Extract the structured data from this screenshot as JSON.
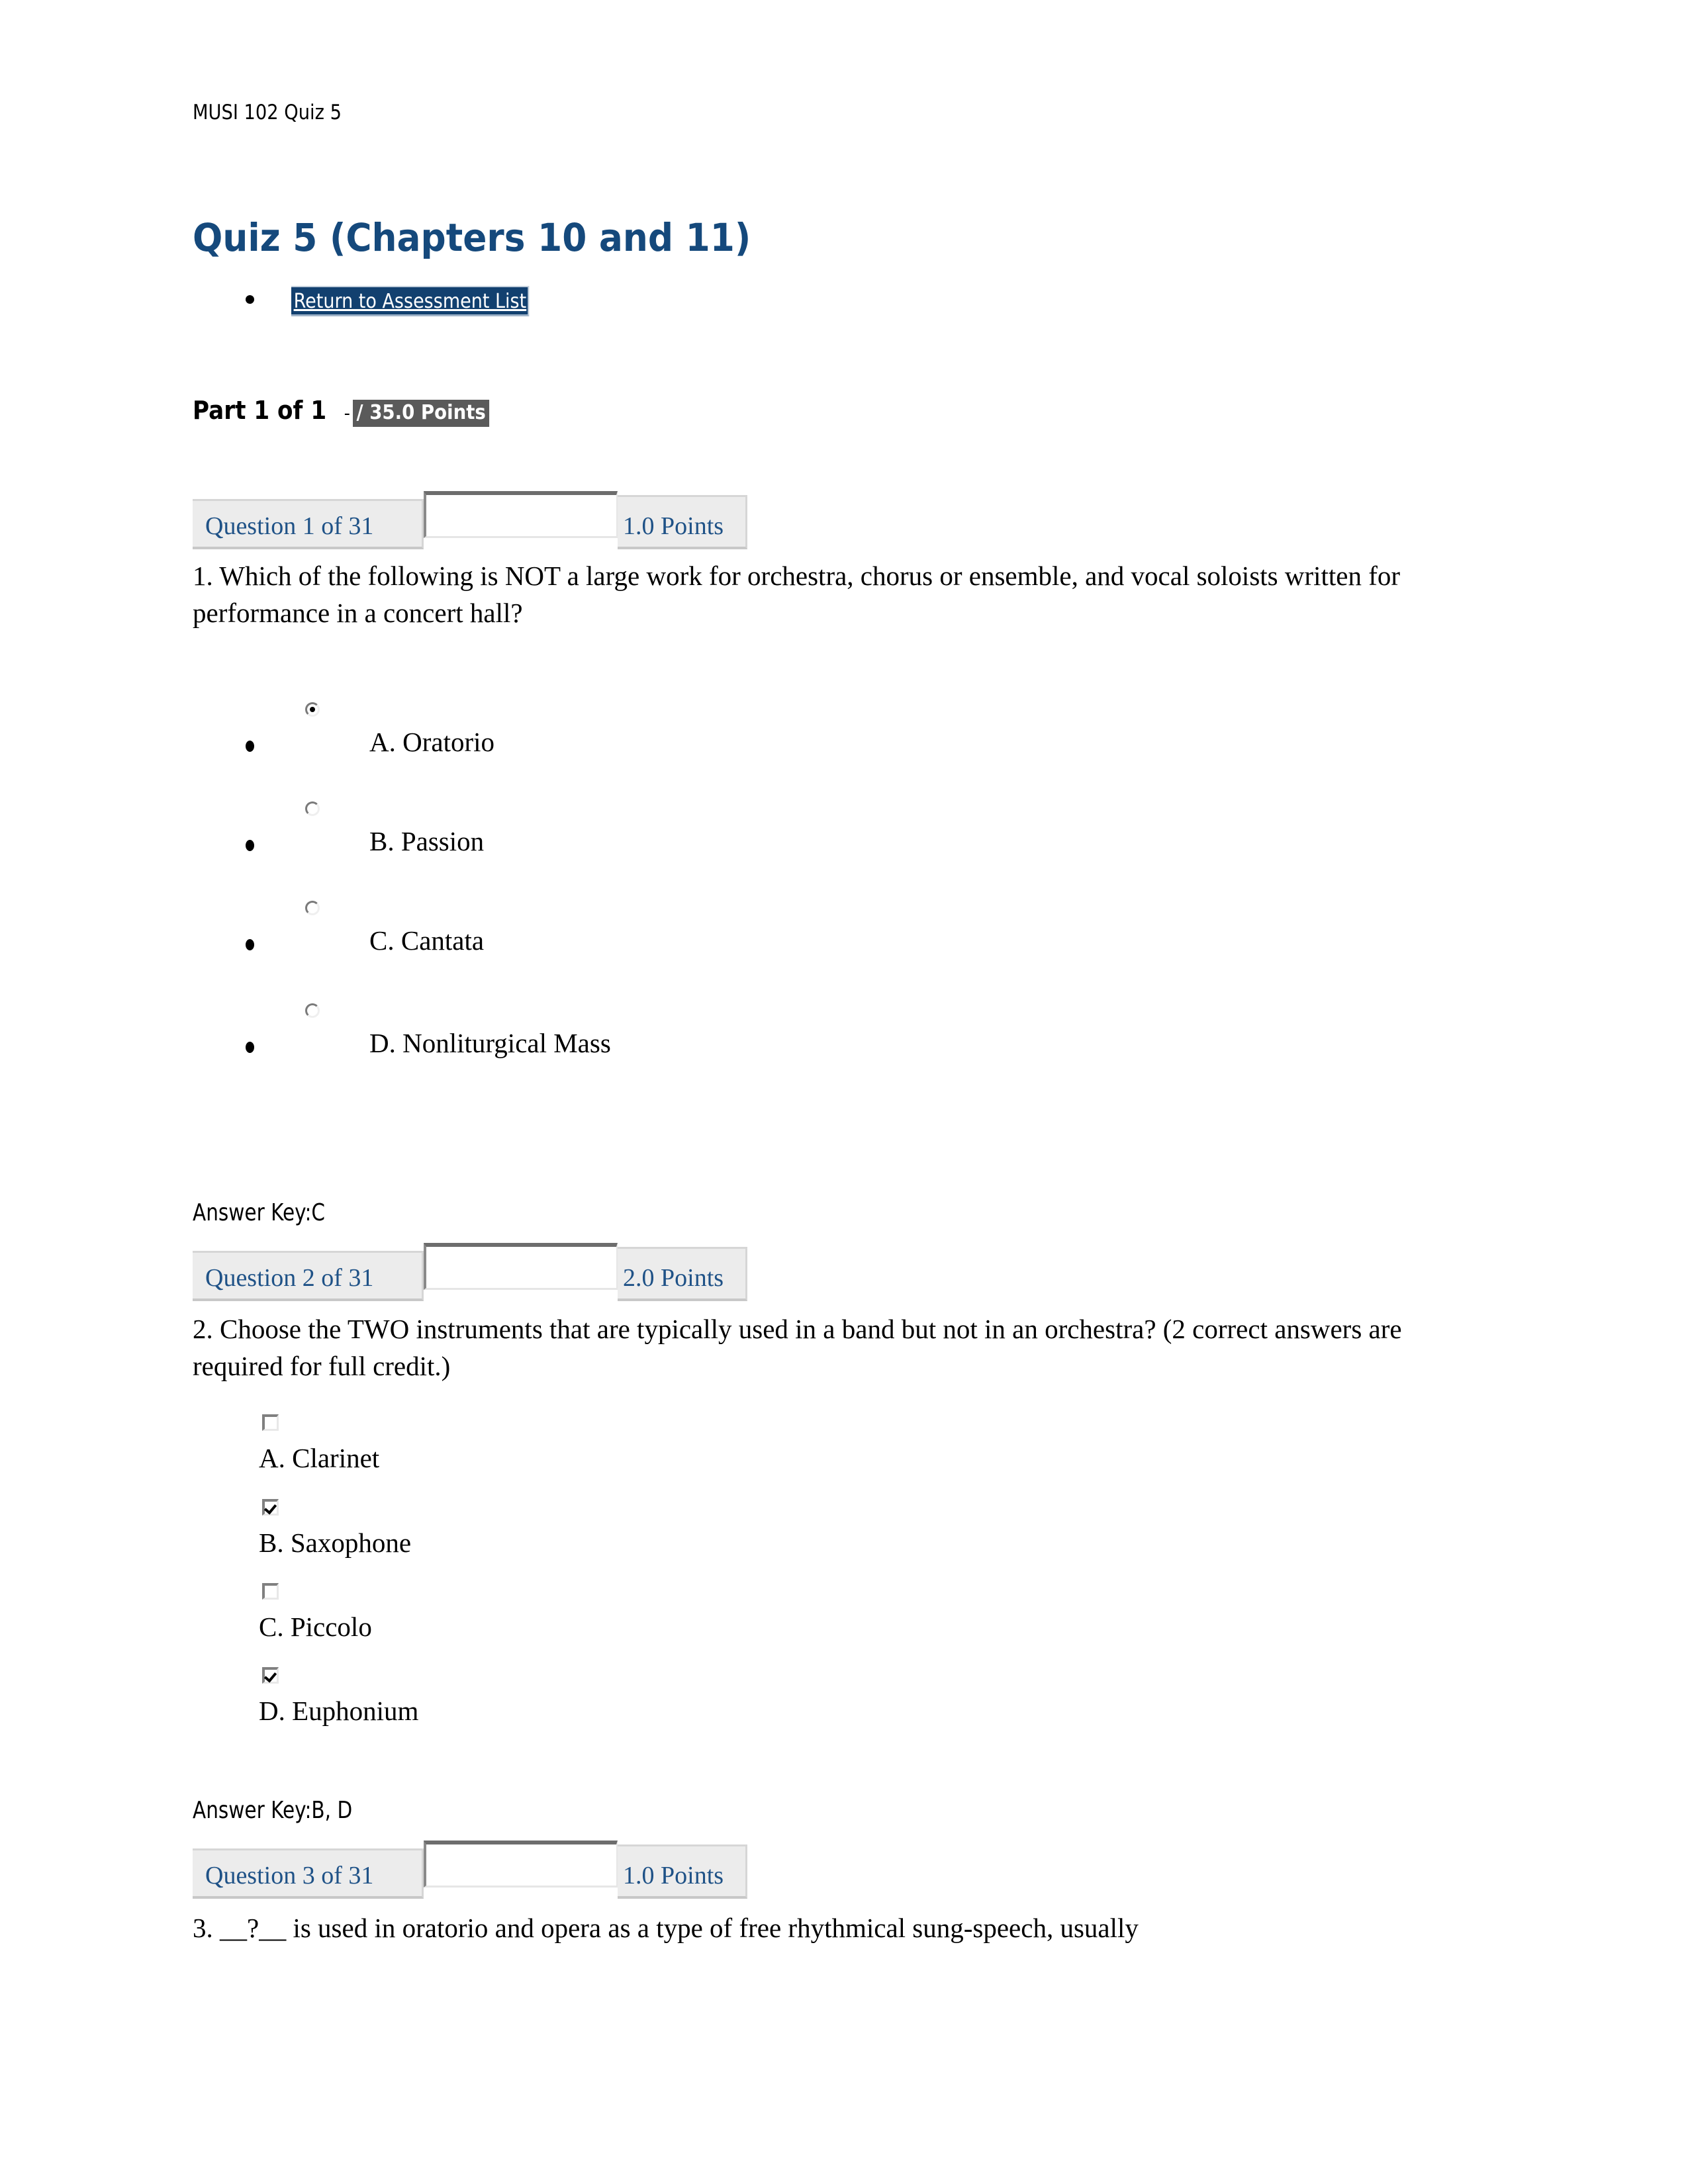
{
  "document": {
    "running_header": "MUSI 102 Quiz 5",
    "title": "Quiz 5 (Chapters 10 and 11)",
    "return_link": "Return to Assessment List",
    "part_label": "Part 1 of 1",
    "part_dash": "-",
    "part_points": "/ 35.0 Points"
  },
  "colors": {
    "title_blue": "#15497c",
    "link_highlight": "#12406f",
    "points_highlight": "#5a5a5a",
    "cell_gray": "#ececec",
    "cell_text_blue": "#1f5287"
  },
  "questions": [
    {
      "header_label": "Question 1 of 31",
      "points": "1.0 Points",
      "input_value": "",
      "text": "1. Which of the following is NOT a large work for orchestra, chorus or ensemble, and vocal soloists written for performance in a concert hall?",
      "input_type": "radio",
      "options": [
        {
          "label": "A. Oratorio",
          "selected": true
        },
        {
          "label": "B. Passion",
          "selected": false
        },
        {
          "label": "C. Cantata",
          "selected": false
        },
        {
          "label": "D. Nonliturgical Mass",
          "selected": false
        }
      ],
      "answer_key": "Answer Key:C"
    },
    {
      "header_label": "Question 2 of 31",
      "points": "2.0 Points",
      "input_value": "",
      "text": "2. Choose the TWO instruments that are typically used in a band but not in an orchestra? (2 correct answers are required for full credit.)",
      "input_type": "checkbox",
      "options": [
        {
          "label": "A. Clarinet",
          "selected": false
        },
        {
          "label": "B. Saxophone",
          "selected": true
        },
        {
          "label": "C. Piccolo",
          "selected": false
        },
        {
          "label": "D. Euphonium",
          "selected": true
        }
      ],
      "answer_key": "Answer Key:B, D"
    },
    {
      "header_label": "Question 3 of 31",
      "points": "1.0 Points",
      "input_value": "",
      "text": "3. __?__ is used in oratorio and opera as a type of free rhythmical sung-speech, usually",
      "input_type": "text",
      "options": [],
      "answer_key": ""
    }
  ]
}
